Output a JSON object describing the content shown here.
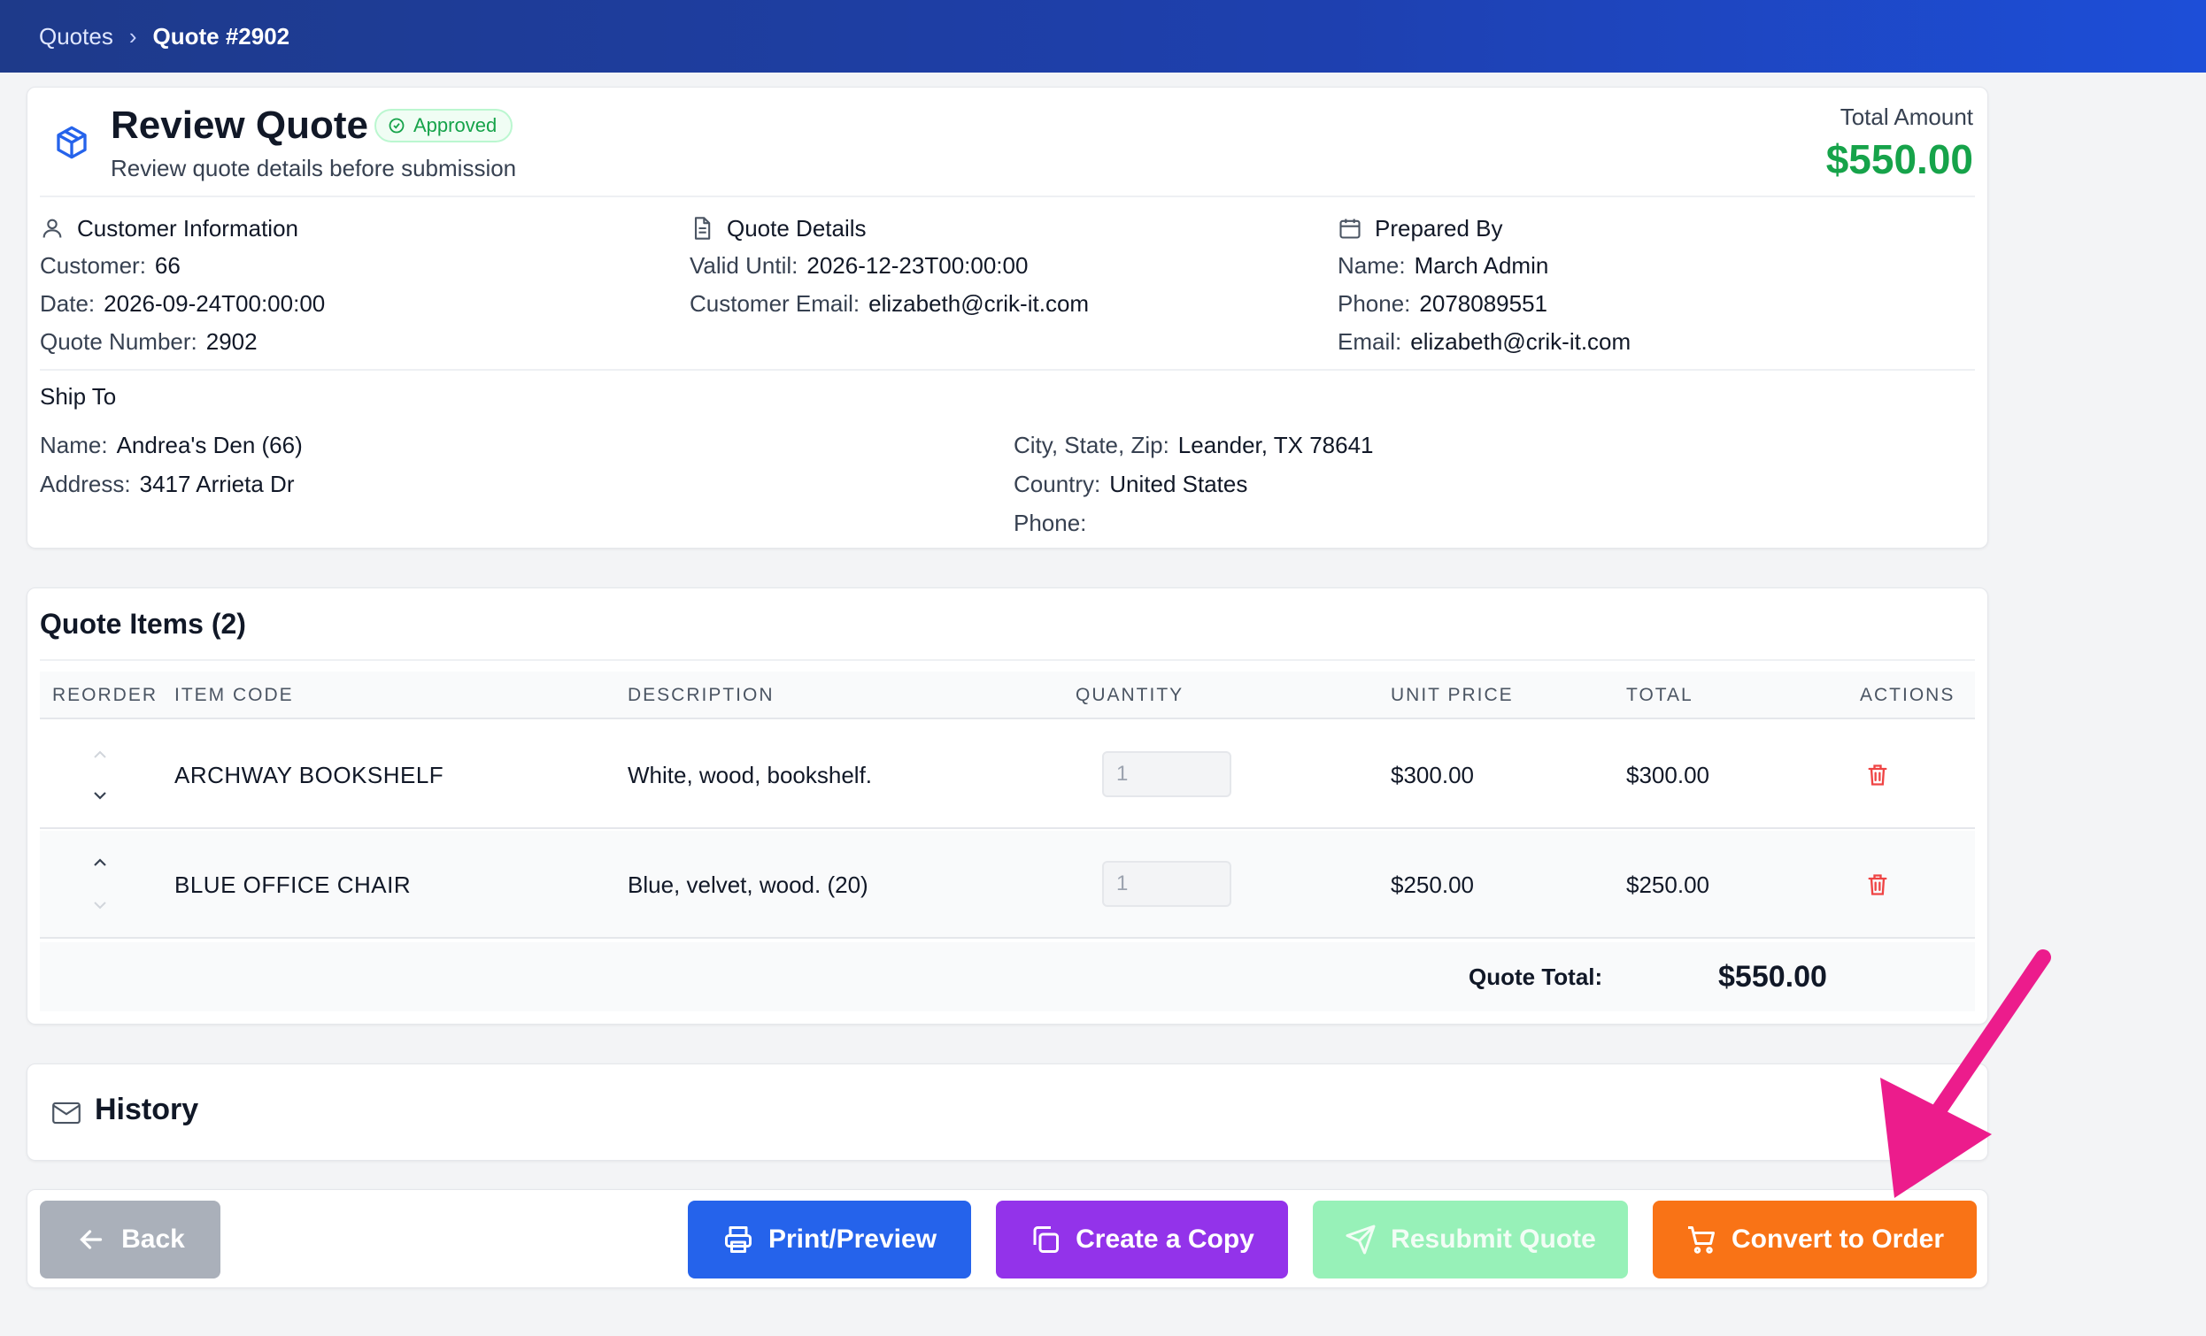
{
  "breadcrumb": {
    "root": "Quotes",
    "separator": "›",
    "current": "Quote #2902"
  },
  "header": {
    "title": "Review Quote",
    "status": "Approved",
    "subtitle": "Review quote details before submission",
    "total_label": "Total Amount",
    "total_amount": "$550.00"
  },
  "customer_info": {
    "heading": "Customer Information",
    "rows": [
      {
        "label": "Customer:",
        "value": "66"
      },
      {
        "label": "Date:",
        "value": "2026-09-24T00:00:00"
      },
      {
        "label": "Quote Number:",
        "value": "2902"
      }
    ]
  },
  "quote_details": {
    "heading": "Quote Details",
    "rows": [
      {
        "label": "Valid Until:",
        "value": "2026-12-23T00:00:00"
      },
      {
        "label": "Customer Email:",
        "value": "elizabeth@crik-it.com"
      }
    ]
  },
  "prepared_by": {
    "heading": "Prepared By",
    "rows": [
      {
        "label": "Name:",
        "value": "March Admin"
      },
      {
        "label": "Phone:",
        "value": "2078089551"
      },
      {
        "label": "Email:",
        "value": "elizabeth@crik-it.com"
      }
    ]
  },
  "ship_to": {
    "heading": "Ship To",
    "left": [
      {
        "label": "Name:",
        "value": "Andrea's Den (66)"
      },
      {
        "label": "Address:",
        "value": "3417 Arrieta Dr"
      }
    ],
    "right": [
      {
        "label": "City, State, Zip:",
        "value": "Leander, TX 78641"
      },
      {
        "label": "Country:",
        "value": "United States"
      },
      {
        "label": "Phone:",
        "value": ""
      }
    ]
  },
  "items": {
    "title": "Quote Items (2)",
    "columns": [
      "REORDER",
      "ITEM CODE",
      "DESCRIPTION",
      "QUANTITY",
      "UNIT PRICE",
      "TOTAL",
      "ACTIONS"
    ],
    "rows": [
      {
        "code": "ARCHWAY BOOKSHELF",
        "description": "White, wood, bookshelf.",
        "quantity": "1",
        "unit_price": "$300.00",
        "total": "$300.00"
      },
      {
        "code": "BLUE OFFICE CHAIR",
        "description": "Blue, velvet, wood. (20)",
        "quantity": "1",
        "unit_price": "$250.00",
        "total": "$250.00"
      }
    ],
    "total_label": "Quote Total:",
    "total_value": "$550.00"
  },
  "history": {
    "title": "History"
  },
  "actions": {
    "back": "Back",
    "print": "Print/Preview",
    "copy": "Create a Copy",
    "resubmit": "Resubmit Quote",
    "convert": "Convert to Order"
  },
  "colors": {
    "topbar": "#1e40af",
    "approved": "#16a34a",
    "print": "#2563eb",
    "copy": "#9333ea",
    "resubmit": "#86efac",
    "convert": "#f97316",
    "back": "#9ca3af",
    "delete": "#ef4444",
    "annotation_arrow": "#ec1c8c"
  },
  "icons": {
    "title": "box-icon",
    "customer": "user-icon",
    "quote_details": "document-icon",
    "prepared_by": "calendar-icon",
    "history": "mail-icon",
    "delete": "trash-icon",
    "back": "arrow-left-icon",
    "print": "printer-icon",
    "copy": "copy-icon",
    "resubmit": "send-icon",
    "convert": "cart-icon"
  }
}
